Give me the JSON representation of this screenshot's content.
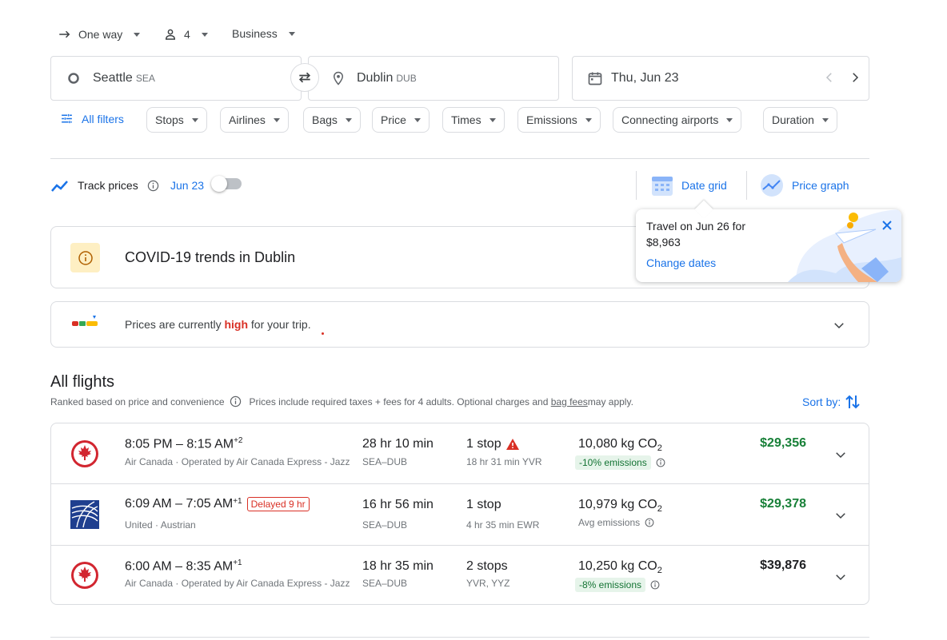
{
  "trip": {
    "type_label": "One way",
    "passengers": "4",
    "cabin": "Business"
  },
  "search": {
    "origin": "Seattle",
    "origin_code": "SEA",
    "destination": "Dublin",
    "destination_code": "DUB",
    "date": "Thu, Jun 23"
  },
  "filters": {
    "all_filters": "All filters",
    "chips": [
      "Stops",
      "Airlines",
      "Bags",
      "Price",
      "Times",
      "Emissions",
      "Connecting airports",
      "Duration"
    ]
  },
  "track": {
    "label": "Track prices",
    "date": "Jun 23"
  },
  "views": {
    "date_grid": "Date grid",
    "price_graph": "Price graph"
  },
  "tooltip": {
    "line1": "Travel on Jun 26 for",
    "line2": "$8,963",
    "link": "Change dates"
  },
  "covid": {
    "title": "COVID-19 trends in Dublin"
  },
  "price_insight": {
    "prefix": "Prices are currently ",
    "level": "high",
    "suffix": " for your trip."
  },
  "results": {
    "heading": "All flights",
    "ranked": "Ranked based on price and convenience",
    "taxes_note": "Prices include required taxes + fees for 4 adults. Optional charges and ",
    "bag_fees": "bag fees",
    "may_apply": " may apply.",
    "sort_label": "Sort by:",
    "flights": [
      {
        "times": "8:05 PM – 8:15 AM",
        "day_offset": "+2",
        "delay": "",
        "airline": "Air Canada · Operated by Air Canada Express - Jazz",
        "duration": "28 hr 10 min",
        "route": "SEA–DUB",
        "stops": "1 stop",
        "stop_detail": "18 hr 31 min YVR",
        "co2": "10,080 kg CO",
        "emissions": "-10% emissions",
        "price": "$29,356",
        "logo": "air-canada",
        "price_color": "#188038"
      },
      {
        "times": "6:09 AM – 7:05 AM",
        "day_offset": "+1",
        "delay": "Delayed 9 hr",
        "airline": "United · Austrian",
        "duration": "16 hr 56 min",
        "route": "SEA–DUB",
        "stops": "1 stop",
        "stop_detail": "4 hr 35 min EWR",
        "co2": "10,979 kg CO",
        "emissions": "Avg emissions",
        "price": "$29,378",
        "logo": "united",
        "price_color": "#188038"
      },
      {
        "times": "6:00 AM – 8:35 AM",
        "day_offset": "+1",
        "delay": "",
        "airline": "Air Canada · Operated by Air Canada Express - Jazz",
        "duration": "18 hr 35 min",
        "route": "SEA–DUB",
        "stops": "2 stops",
        "stop_detail": "YVR, YYZ",
        "co2": "10,250 kg CO",
        "emissions": "-8% emissions",
        "price": "$39,876",
        "logo": "air-canada",
        "price_color": "#202124"
      }
    ]
  },
  "colors": {
    "accent": "#1a73e8",
    "high": "#d93025",
    "green": "#188038"
  }
}
